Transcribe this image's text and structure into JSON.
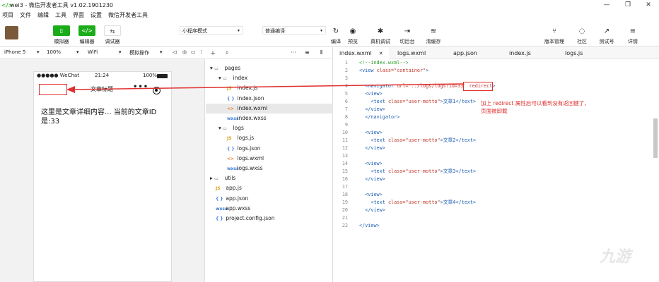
{
  "window": {
    "title": "wei3 - 微信开发者工具 v1.02.1901230",
    "controls": [
      "—",
      "❐",
      "✕"
    ]
  },
  "menu": [
    "项目",
    "文件",
    "编辑",
    "工具",
    "界面",
    "设置",
    "微信开发者工具"
  ],
  "toolbar": {
    "simulator": "模拟器",
    "editor": "编辑器",
    "debugger": "调试器",
    "mode": "小程序模式",
    "compile_mode": "普通编译",
    "compile": "编译",
    "preview": "预览",
    "remote_debug": "真机调试",
    "background": "切后台",
    "clear_cache": "清缓存",
    "version": "版本管理",
    "community": "社区",
    "test": "测试号",
    "details": "详情"
  },
  "device_bar": {
    "device": "iPhone 5",
    "zoom": "100%",
    "network": "WiFi",
    "operation": "模拟操作"
  },
  "phone": {
    "carrier": "●●●●● WeChat",
    "time": "21:24",
    "battery": "100%",
    "nav_title": "文章标题",
    "dots": "•••",
    "content": "这里是文章详细内容... 当前的文章ID是:33"
  },
  "tree": {
    "items": [
      {
        "label": "pages",
        "type": "folder"
      },
      {
        "label": "index",
        "type": "folder"
      },
      {
        "label": "index.js",
        "type": "js"
      },
      {
        "label": "index.json",
        "type": "json"
      },
      {
        "label": "index.wxml",
        "type": "wxml"
      },
      {
        "label": "index.wxss",
        "type": "wxss"
      },
      {
        "label": "logs",
        "type": "folder"
      },
      {
        "label": "logs.js",
        "type": "js"
      },
      {
        "label": "logs.json",
        "type": "json"
      },
      {
        "label": "logs.wxml",
        "type": "wxml"
      },
      {
        "label": "logs.wxss",
        "type": "wxss"
      },
      {
        "label": "utils",
        "type": "folder"
      },
      {
        "label": "app.js",
        "type": "js"
      },
      {
        "label": "app.json",
        "type": "json"
      },
      {
        "label": "app.wxss",
        "type": "wxss"
      },
      {
        "label": "project.config.json",
        "type": "json"
      }
    ]
  },
  "tabs": [
    "index.wxml",
    "logs.wxml",
    "app.json",
    "index.js",
    "logs.js"
  ],
  "code": {
    "l1": "<!--index.wxml-->",
    "l2a": "<view ",
    "l2b": "class=",
    "l2c": "\"container\"",
    "l2d": ">",
    "l4a": "<navigator ",
    "l4b": "url=",
    "l4c": "'../logs/logs?id=33'",
    "l4d": " redirect",
    "l4e": ">",
    "l5": "<view>",
    "l6a": "<text ",
    "l6b": "class=",
    "l6c": "\"user-motto\"",
    "l6d": ">文章1</text>",
    "l7": "</view>",
    "l8": "</navigator>",
    "l10": "<view>",
    "l11d": ">文章2</text>",
    "l12": "</view>",
    "l14": "<view>",
    "l15d": ">文章3</text>",
    "l16": "</view>",
    "l18": "<view>",
    "l19d": ">文章4</text>",
    "l20": "</view>",
    "l22": "</view>"
  },
  "annotation": {
    "line1": "加上 redirect 属性后可以看到没有返回键了，",
    "line2": "页面被卸载"
  },
  "watermark": "九游"
}
